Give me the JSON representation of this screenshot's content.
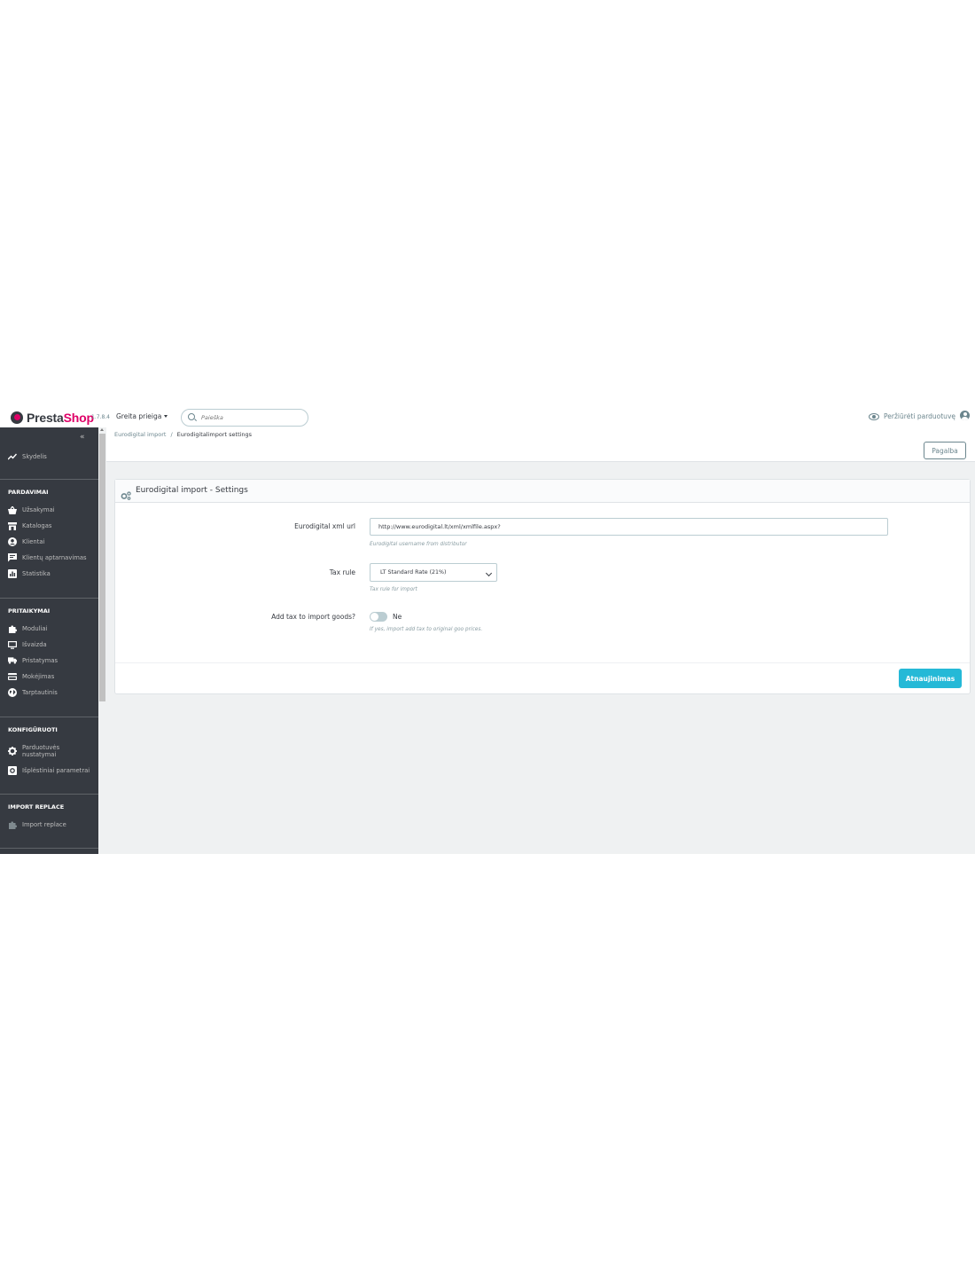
{
  "header": {
    "logo_part1": "Presta",
    "logo_part2": "Shop",
    "version": "1.7.8.4",
    "quick_access": "Greita prieiga",
    "search_placeholder": "Paieška",
    "view_shop": "Peržiūrėti parduotuvę"
  },
  "sidebar": {
    "collapse": "«",
    "dashboard": "Skydelis",
    "sections": [
      {
        "title": "PARDAVIMAI",
        "items": [
          "Užsakymai",
          "Katalogas",
          "Klientai",
          "Klientų aptarnavimas",
          "Statistika"
        ]
      },
      {
        "title": "PRITAIKYMAI",
        "items": [
          "Moduliai",
          "Išvaizda",
          "Pristatymas",
          "Mokėjimas",
          "Tarptautinis"
        ]
      },
      {
        "title": "KONFIGŪRUOTI",
        "items": [
          "Parduotuvės nustatymai",
          "Išplėstiniai parametrai"
        ]
      },
      {
        "title": "IMPORT REPLACE",
        "items": [
          "Import replace"
        ]
      }
    ]
  },
  "breadcrumb": {
    "parent": "Eurodigital import",
    "separator": "/",
    "current": "Eurodigitalimport settings"
  },
  "toolbar": {
    "help_label": "Pagalba"
  },
  "panel": {
    "title": "Eurodigital import - Settings",
    "fields": {
      "xml_url": {
        "label": "Eurodigital xml url",
        "value": "http://www.eurodigital.lt/xml/xmlfile.aspx?",
        "help": "Eurodigital username from distributor"
      },
      "tax_rule": {
        "label": "Tax rule",
        "value": "LT Standard Rate (21%)",
        "help": "Tax rule for import"
      },
      "add_tax": {
        "label": "Add tax to import goods?",
        "value": "Ne",
        "help": "If yes, import add tax to original goo prices."
      }
    },
    "save_label": "Atnaujinimas"
  },
  "colors": {
    "accent": "#25b9d7",
    "brand": "#df0067",
    "sidebar": "#363a41"
  }
}
